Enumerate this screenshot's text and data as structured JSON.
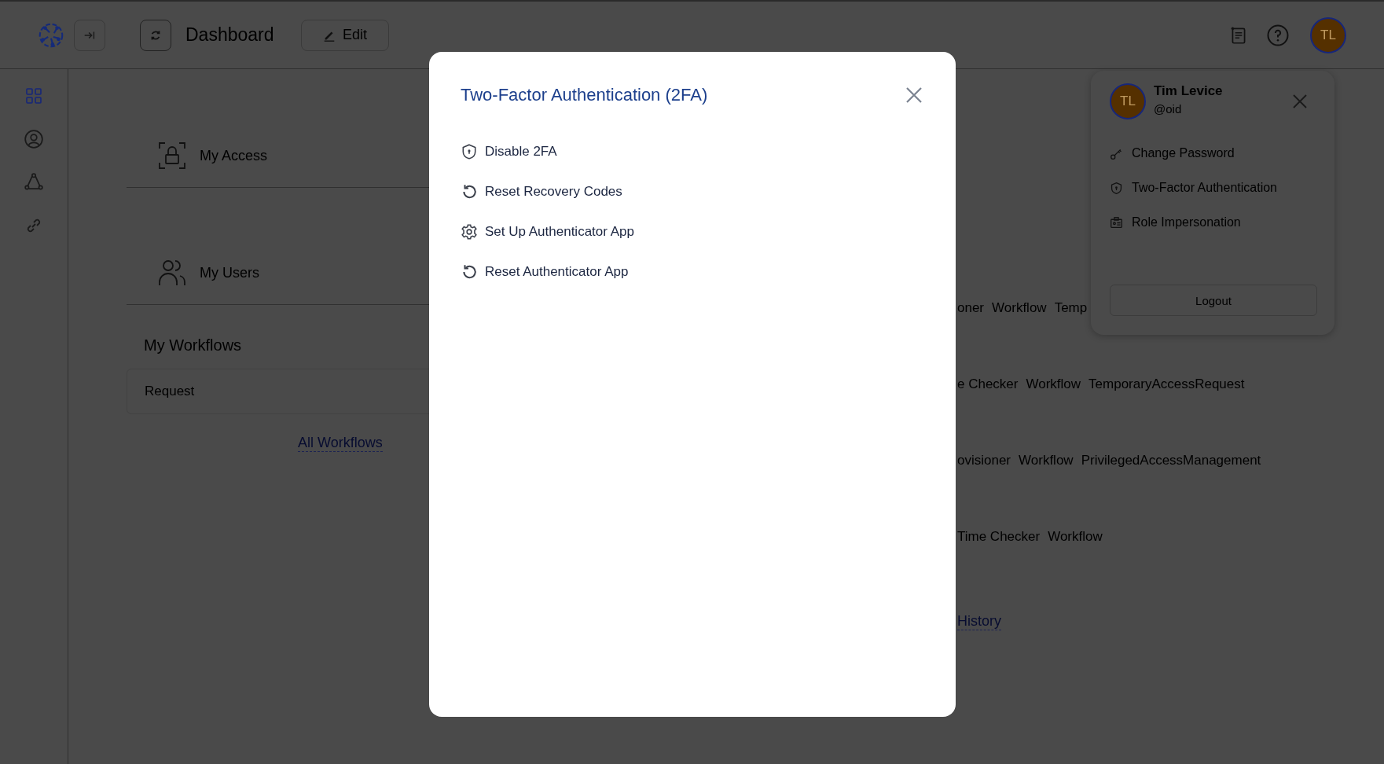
{
  "header": {
    "title": "Dashboard",
    "edit_button": "Edit"
  },
  "sidebar": {
    "items": [
      {
        "kind": "grid",
        "selected": true
      },
      {
        "kind": "user",
        "selected": false
      },
      {
        "kind": "network",
        "selected": false
      },
      {
        "kind": "link",
        "selected": false
      }
    ]
  },
  "cards": [
    {
      "kind": "access",
      "label": "My Access"
    },
    {
      "kind": "users",
      "label": "My Users"
    }
  ],
  "workflows": {
    "title": "My Workflows",
    "column_1": "Request",
    "link": "All Workflows"
  },
  "workflow_rows": [
    {
      "cells": [
        "oner",
        "Workflow",
        "Temp"
      ]
    },
    {
      "cells": [
        "e Checker",
        "Workflow",
        "TemporaryAccessRequest"
      ]
    },
    {
      "cells": [
        "ovisioner",
        "Workflow",
        "PrivilegedAccessManagement"
      ]
    },
    {
      "cells": [
        "Time Checker",
        "Workflow"
      ]
    }
  ],
  "history_link": "History",
  "avatar": {
    "initials": "TL"
  },
  "dialog": {
    "title": "Two-Factor Authentication (2FA)",
    "items": [
      {
        "kind": "shield",
        "label": "Disable 2FA"
      },
      {
        "kind": "reset",
        "label": "Reset Recovery Codes"
      },
      {
        "kind": "gear",
        "label": "Set Up Authenticator App"
      },
      {
        "kind": "reset",
        "label": "Reset Authenticator App"
      }
    ]
  },
  "profile_menu": {
    "initials": "TL",
    "name": "Tim Levice",
    "handle": "@oid",
    "items": [
      {
        "kind": "key",
        "label": "Change Password"
      },
      {
        "kind": "shield",
        "label": "Two-Factor Authentication"
      },
      {
        "kind": "badge",
        "label": "Role Impersonation"
      }
    ],
    "logout": "Logout"
  }
}
